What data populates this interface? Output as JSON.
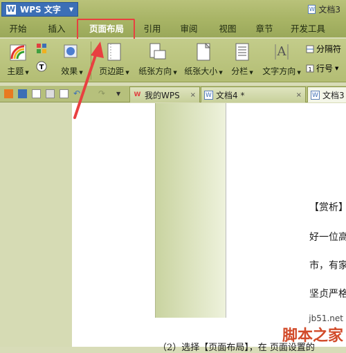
{
  "app": {
    "name": "WPS 文字",
    "logo": "W"
  },
  "window": {
    "doc_title": "文档3"
  },
  "menu": {
    "items": [
      "开始",
      "插入",
      "页面布局",
      "引用",
      "审阅",
      "视图",
      "章节",
      "开发工具"
    ],
    "active": "页面布局"
  },
  "ribbon": {
    "theme": "主题",
    "effect": "效果",
    "margin": "页边距",
    "orientation": "纸张方向",
    "size": "纸张大小",
    "columns": "分栏",
    "text_direction": "文字方向",
    "separator": "分隔符",
    "line_number": "行号"
  },
  "tabs": {
    "items": [
      "我的WPS",
      "文档4 *",
      "文档3"
    ]
  },
  "document": {
    "lines": [
      "【赏析】",
      "好一位高",
      "市，有家",
      "坚贞严格"
    ],
    "bottom_line": "（2）选择【页面布局】，在 页面设置的"
  },
  "watermark": {
    "site": "jb51.net",
    "brand": "脚本之家"
  },
  "colors": {
    "accent_red": "#e84040",
    "app_blue": "#3c6fb6",
    "ribbon": "#b3bd74"
  }
}
